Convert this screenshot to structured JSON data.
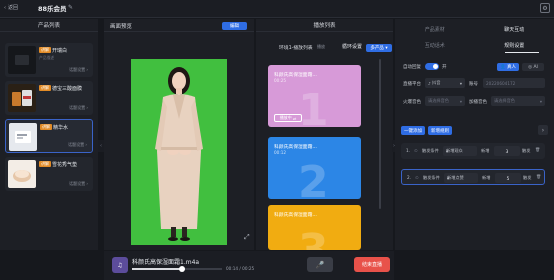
{
  "header": {
    "back_label": "返回",
    "title": "88乐会员"
  },
  "left": {
    "title": "产品列表",
    "products": [
      {
        "tag": "讲解",
        "name": "开瑞白",
        "sub": "产品描述",
        "action": "话题设置"
      },
      {
        "tag": "讲解",
        "name": "德宝三酸面膜",
        "sub": "",
        "action": "话题设置"
      },
      {
        "tag": "讲解",
        "name": "精华水",
        "sub": "",
        "action": "话题设置"
      },
      {
        "tag": "讲解",
        "name": "雪花秀气垫",
        "sub": "",
        "action": "话题设置"
      }
    ]
  },
  "center": {
    "title": "画面预览",
    "edit_label": "编辑"
  },
  "playlist": {
    "title": "播放列表",
    "name": "环境1-播放列表",
    "mode": "播放",
    "loop_label": "循环设置",
    "dropdown": "多产品",
    "cards": [
      {
        "title": "科颜氏高保湿面霜...",
        "time": "00:25",
        "num": "1",
        "action": "播放中",
        "color": "#d79ad8"
      },
      {
        "title": "科颜氏高保湿面霜...",
        "time": "00:12",
        "num": "2",
        "action": "",
        "color": "#2c86e6"
      },
      {
        "title": "科颜氏高保湿面霜...",
        "time": "",
        "num": "3",
        "action": "",
        "color": "#f1ac11"
      }
    ]
  },
  "right": {
    "tabs_row1": [
      "产品素材",
      "聊天互动"
    ],
    "tabs_row2": [
      "互动话术",
      "规则设置"
    ],
    "auto_label": "自动回复",
    "toggle_state": "开",
    "pill_primary": "真人",
    "pill_secondary": "AI",
    "platform_label": "直播平台",
    "platform_value": "抖音",
    "account_label": "账号",
    "account_value": "20220604172",
    "pick_label": "火爆音色",
    "pick_placeholder": "请选择音色",
    "voice_label": "加播音色",
    "voice_placeholder": "请选择音色",
    "add_btn": "一键添加",
    "new_rule_btn": "新增规则",
    "rules": [
      {
        "index": "1.",
        "cond_label": "触发条件",
        "cond_value": "新增观众",
        "op": "新增",
        "count": "3",
        "unit": "触发"
      },
      {
        "index": "2.",
        "cond_label": "触发条件",
        "cond_value": "新增点赞",
        "op": "新增",
        "count": "5",
        "unit": "触发"
      }
    ]
  },
  "bottom": {
    "file_name": "科颜氏高保湿面霜1.m4a",
    "time_current": "00:14",
    "time_total": "00:25",
    "progress": 0.56,
    "live_label": "结束直播"
  }
}
